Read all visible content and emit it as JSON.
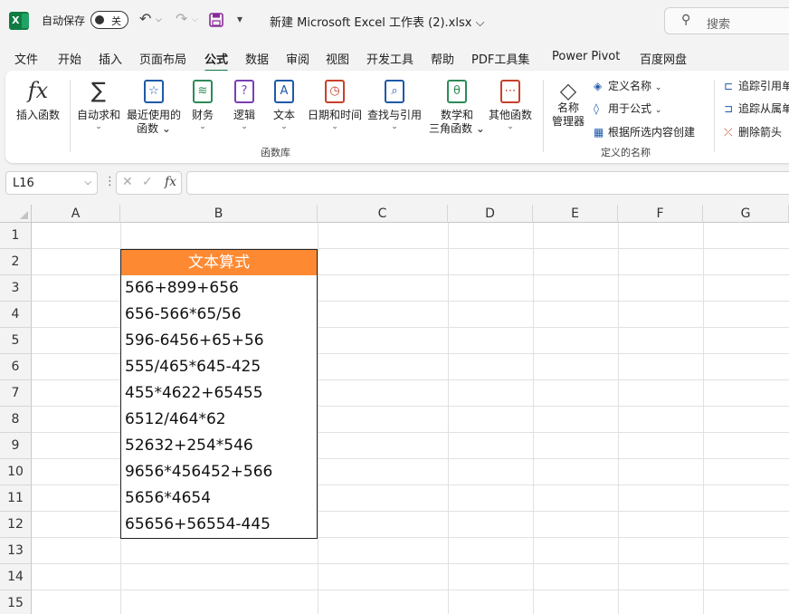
{
  "titlebar": {
    "app_icon": "X",
    "autosave_label": "自动保存",
    "autosave_state": "关",
    "undo_icon": "↶",
    "redo_icon": "↷",
    "save_icon": "save-icon",
    "customize_icon": "▾",
    "doc_title": "新建 Microsoft Excel 工作表 (2).xlsx ⌵",
    "search_placeholder": "搜索"
  },
  "menu": {
    "tabs": [
      "文件",
      "开始",
      "插入",
      "页面布局",
      "公式",
      "数据",
      "审阅",
      "视图",
      "开发工具",
      "帮助",
      "PDF工具集",
      "Power Pivot",
      "百度网盘"
    ],
    "active": "公式"
  },
  "ribbon": {
    "insert_function": "插入函数",
    "autosum": "自动求和",
    "recent_1": "最近使用的",
    "recent_2": "函数",
    "financial": "财务",
    "logical": "逻辑",
    "text": "文本",
    "datetime": "日期和时间",
    "lookup": "查找与引用",
    "math_1": "数学和",
    "math_2": "三角函数",
    "more": "其他函数",
    "library_group": "函数库",
    "name_manager_1": "名称",
    "name_manager_2": "管理器",
    "define_name": "定义名称",
    "use_in_formula": "用于公式",
    "create_from_selection": "根据所选内容创建",
    "names_group": "定义的名称",
    "trace_precedents": "追踪引用单",
    "trace_dependents": "追踪从属单",
    "remove_arrows": "删除箭头"
  },
  "formula_bar": {
    "name_box": "L16",
    "fx": "fx",
    "content": ""
  },
  "grid": {
    "columns": [
      "A",
      "B",
      "C",
      "D",
      "E",
      "F",
      "G"
    ],
    "rows": [
      "1",
      "2",
      "3",
      "4",
      "5",
      "6",
      "7",
      "8",
      "9",
      "10",
      "11",
      "12",
      "13",
      "14",
      "15"
    ],
    "header_cell": "文本算式",
    "header_color": "#fd8a33",
    "cells": [
      "566+899+656",
      "656-566*65/56",
      "596-6456+65+56",
      "555/465*645-425",
      "455*4622+65455",
      "6512/464*62",
      "52632+254*546",
      "9656*456452+566",
      "5656*4654",
      "65656+56554-445"
    ]
  }
}
